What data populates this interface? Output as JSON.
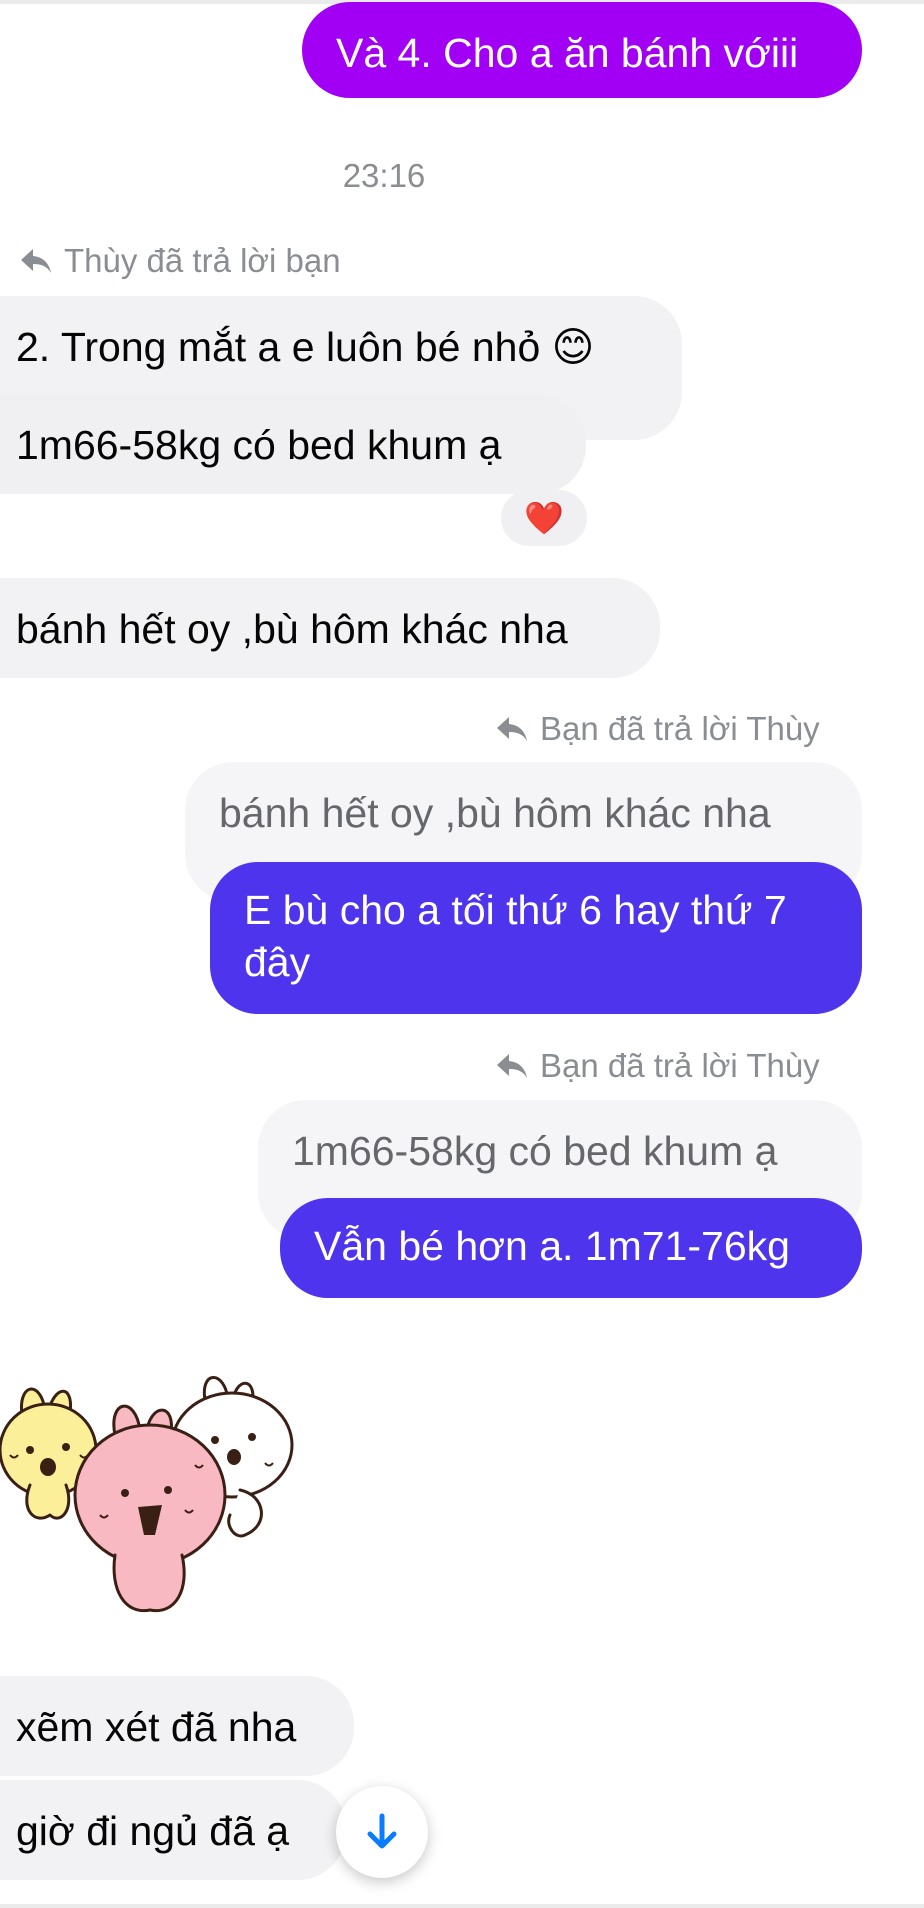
{
  "messages": {
    "m1_out": "Và 4. Cho a ăn bánh vớiii",
    "time": "23:16",
    "reply_note_in": "Thùy đã trả lời bạn",
    "m2_in": "2. Trong mắt a e luôn bé nhỏ 😊",
    "m3_in": "1m66-58kg có bed khum ạ",
    "reaction": "❤️",
    "m4_in": "bánh hết  oy ,bù hôm khác nha",
    "reply_note_out_1": "Bạn đã trả lời Thùy",
    "quote_1": "bánh hết  oy ,bù hôm khác nha",
    "m5_out": "E bù cho a tối thứ 6 hay thứ 7 đây",
    "reply_note_out_2": "Bạn đã trả lời Thùy",
    "quote_2": "1m66-58kg có bed khum ạ",
    "m6_out": "Vẫn bé hơn a. 1m71-76kg",
    "m7_in": "xẽm xét đã nha",
    "m8_in": "giờ đi ngủ đã ạ"
  },
  "colors": {
    "purple_bubble": "#a100f5",
    "blue_bubble": "#4f34ee",
    "incoming_bubble": "#f2f2f4",
    "scroll_arrow": "#0a7cff"
  },
  "icons": {
    "reply": "reply-arrow-icon",
    "scroll": "arrow-down-icon",
    "sticker": "bunny-sticker"
  }
}
